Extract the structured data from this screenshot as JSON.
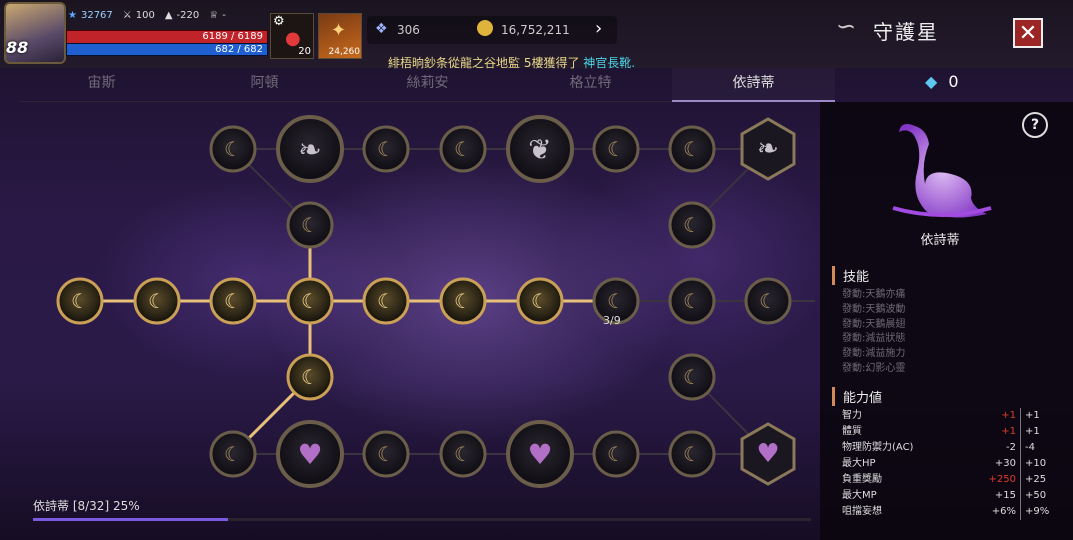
{
  "player": {
    "level": "88",
    "power": "32767",
    "stat_a": "100",
    "stat_b": "-220",
    "stat_c": "-",
    "hp": "6189 / 6189",
    "mp": "682 / 682",
    "potion_count": "20",
    "item_count": "24,260"
  },
  "currency": {
    "crystal": "306",
    "gold": "16,752,211"
  },
  "header": {
    "title": "守護星",
    "close": "✕"
  },
  "marquee": {
    "text": "緋梧晌鈔条從龍之谷地監 5樓獲得了",
    "highlight": "神官長靴."
  },
  "tabs": [
    "宙斯",
    "阿頓",
    "絲莉安",
    "格立特",
    "依詩蒂"
  ],
  "active_tab": 4,
  "gem_count": "0",
  "boss": {
    "name": "依詩蒂",
    "color": "#b06be8"
  },
  "skills": {
    "title": "技能",
    "items": [
      "發動:天鵝亦痛",
      "發動:天鵝波動",
      "發動:天鵝晨翅",
      "發動:減益狀態",
      "發動:減益施力",
      "發動:幻影心靈"
    ]
  },
  "abilities": {
    "title": "能力値",
    "rows": [
      {
        "label": "智力",
        "current": "+1",
        "next": "+1",
        "current_red": true
      },
      {
        "label": "體質",
        "current": "+1",
        "next": "+1",
        "current_red": true
      },
      {
        "label": "物理防禦力(AC)",
        "current": "-2",
        "next": "-4",
        "current_red": false
      },
      {
        "label": "最大HP",
        "current": "+30",
        "next": "+10",
        "current_red": false
      },
      {
        "label": "負重獎勵",
        "current": "+250",
        "next": "+25",
        "current_red": true
      },
      {
        "label": "最大MP",
        "current": "+15",
        "next": "+50",
        "current_red": false
      },
      {
        "label": "咀擋妄想",
        "current": "+6%",
        "next": "+9%",
        "current_red": false
      }
    ]
  },
  "progress": {
    "label": "依詩蒂 [8/32] 25%",
    "fraction": 0.25
  },
  "node_counter": "3/9",
  "colors": {
    "gold_line": "#e7c07a",
    "dim_line": "#3a3340",
    "progress": "#7a5ae0"
  }
}
